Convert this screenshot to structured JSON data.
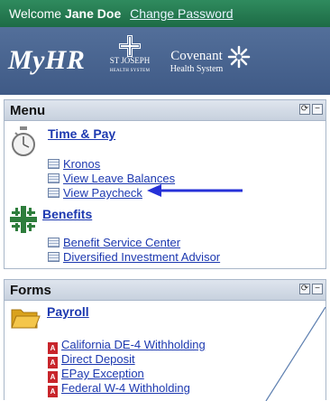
{
  "welcome": {
    "prefix": "Welcome",
    "user": "Jane Doe",
    "change_password": "Change Password"
  },
  "banner": {
    "app_name": "MyHR",
    "stjoseph_line1": "ST JOSEPH",
    "stjoseph_line2": "HEALTH SYSTEM",
    "covenant_line1": "Covenant",
    "covenant_line2": "Health System"
  },
  "menu": {
    "title": "Menu",
    "sections": [
      {
        "title": "Time & Pay",
        "icon": "stopwatch-icon",
        "links": [
          "Kronos",
          "View Leave Balances",
          "View Paycheck"
        ]
      },
      {
        "title": "Benefits",
        "icon": "benefits-cross-icon",
        "links": [
          "Benefit Service Center",
          "Diversified Investment Advisor"
        ]
      }
    ]
  },
  "forms": {
    "title": "Forms",
    "sections": [
      {
        "title": "Payroll",
        "icon": "folder-icon",
        "links": [
          "California DE-4 Withholding",
          "Direct Deposit",
          "EPay Exception",
          "Federal W-4 Withholding"
        ]
      }
    ]
  },
  "colors": {
    "welcome_bar": "#2f8b5e",
    "banner": "#536f9a",
    "link": "#1d39b0",
    "annotation_arrow": "#2631d8"
  }
}
